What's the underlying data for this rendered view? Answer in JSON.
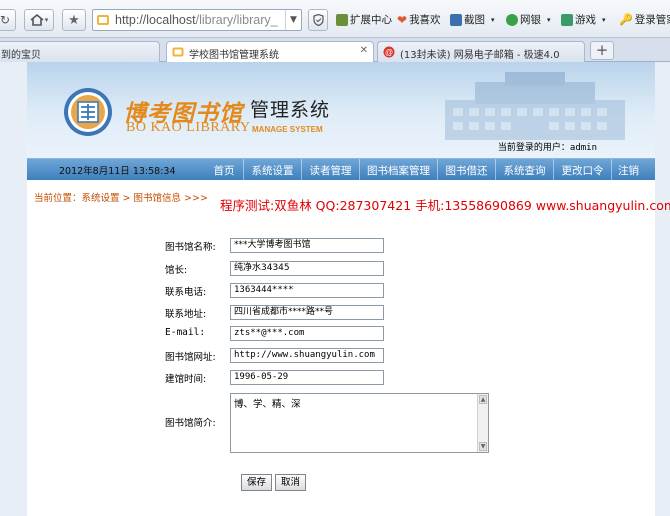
{
  "browser": {
    "url_host": "http://localhost",
    "url_path": "/library/library_",
    "bookmarks": [
      {
        "label": "扩展中心",
        "color": "#6a8f3a"
      },
      {
        "label": "我喜欢",
        "color": "#e05a2a"
      },
      {
        "label": "截图",
        "color": "#3c6fb0"
      },
      {
        "label": "网银",
        "color": "#3aa04a"
      },
      {
        "label": "游戏",
        "color": "#3a9a6a"
      },
      {
        "label": "登录管家",
        "color": "#2f6bb8"
      }
    ],
    "tabs": [
      {
        "label": "到的宝贝"
      },
      {
        "label": "学校图书馆管理系统"
      },
      {
        "label": "(13封未读) 网易电子邮箱 - 极速4.0"
      }
    ],
    "new_tab_label": "+"
  },
  "header": {
    "title_cn": "博考图书馆",
    "title_system": "管理系统",
    "title_en": "BO KAO LIBRARY",
    "title_en_sub": "MANAGE SYSTEM",
    "current_user_label": "当前登录的用户：",
    "current_user": "admin",
    "datetime": "2012年8月11日  13:58:34"
  },
  "nav": [
    {
      "label": "首页"
    },
    {
      "label": "系统设置"
    },
    {
      "label": "读者管理"
    },
    {
      "label": "图书档案管理"
    },
    {
      "label": "图书借还"
    },
    {
      "label": "系统查询"
    },
    {
      "label": "更改口令"
    },
    {
      "label": "注销"
    }
  ],
  "breadcrumb": "当前位置：系统设置 > 图书馆信息  >>>",
  "promo": "程序测试:双鱼林 QQ:287307421 手机:13558690869 www.shuangyulin.com",
  "form": {
    "fields": [
      {
        "label": "图书馆名称:",
        "value": "***大学博考图书馆"
      },
      {
        "label": "馆长:",
        "value": "纯净水34345"
      },
      {
        "label": "联系电话:",
        "value": "1363444****"
      },
      {
        "label": "联系地址:",
        "value": "四川省成都市****路**号"
      },
      {
        "label": "E-mail:",
        "value": "zts**@***.com"
      },
      {
        "label": "图书馆网址:",
        "value": "http://www.shuangyulin.com"
      },
      {
        "label": "建馆时间:",
        "value": "1996-05-29"
      }
    ],
    "intro_label": "图书馆简介:",
    "intro_value": "博、学、精、深",
    "save_label": "保存",
    "cancel_label": "取消"
  }
}
